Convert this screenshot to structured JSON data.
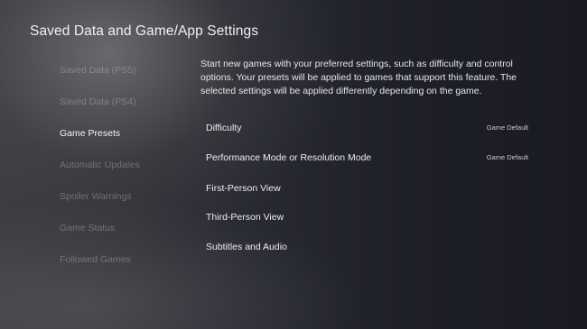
{
  "header": {
    "title": "Saved Data and Game/App Settings"
  },
  "sidebar": {
    "items": [
      {
        "label": "Saved Data (PS5)"
      },
      {
        "label": "Saved Data (PS4)"
      },
      {
        "label": "Game Presets"
      },
      {
        "label": "Automatic Updates"
      },
      {
        "label": "Spoiler Warnings"
      },
      {
        "label": "Game Status"
      },
      {
        "label": "Followed Games"
      }
    ],
    "selected": "Game Presets"
  },
  "main": {
    "description": "Start new games with your preferred settings, such as difficulty and control options. Your presets will be applied to games that support this feature. The selected settings will be applied differently depending on the game.",
    "settings": [
      {
        "label": "Difficulty",
        "value": "Game Default"
      },
      {
        "label": "Performance Mode or Resolution Mode",
        "value": "Game Default"
      },
      {
        "label": "First-Person View",
        "value": ""
      },
      {
        "label": "Third-Person View",
        "value": ""
      },
      {
        "label": "Subtitles and Audio",
        "value": ""
      }
    ]
  }
}
